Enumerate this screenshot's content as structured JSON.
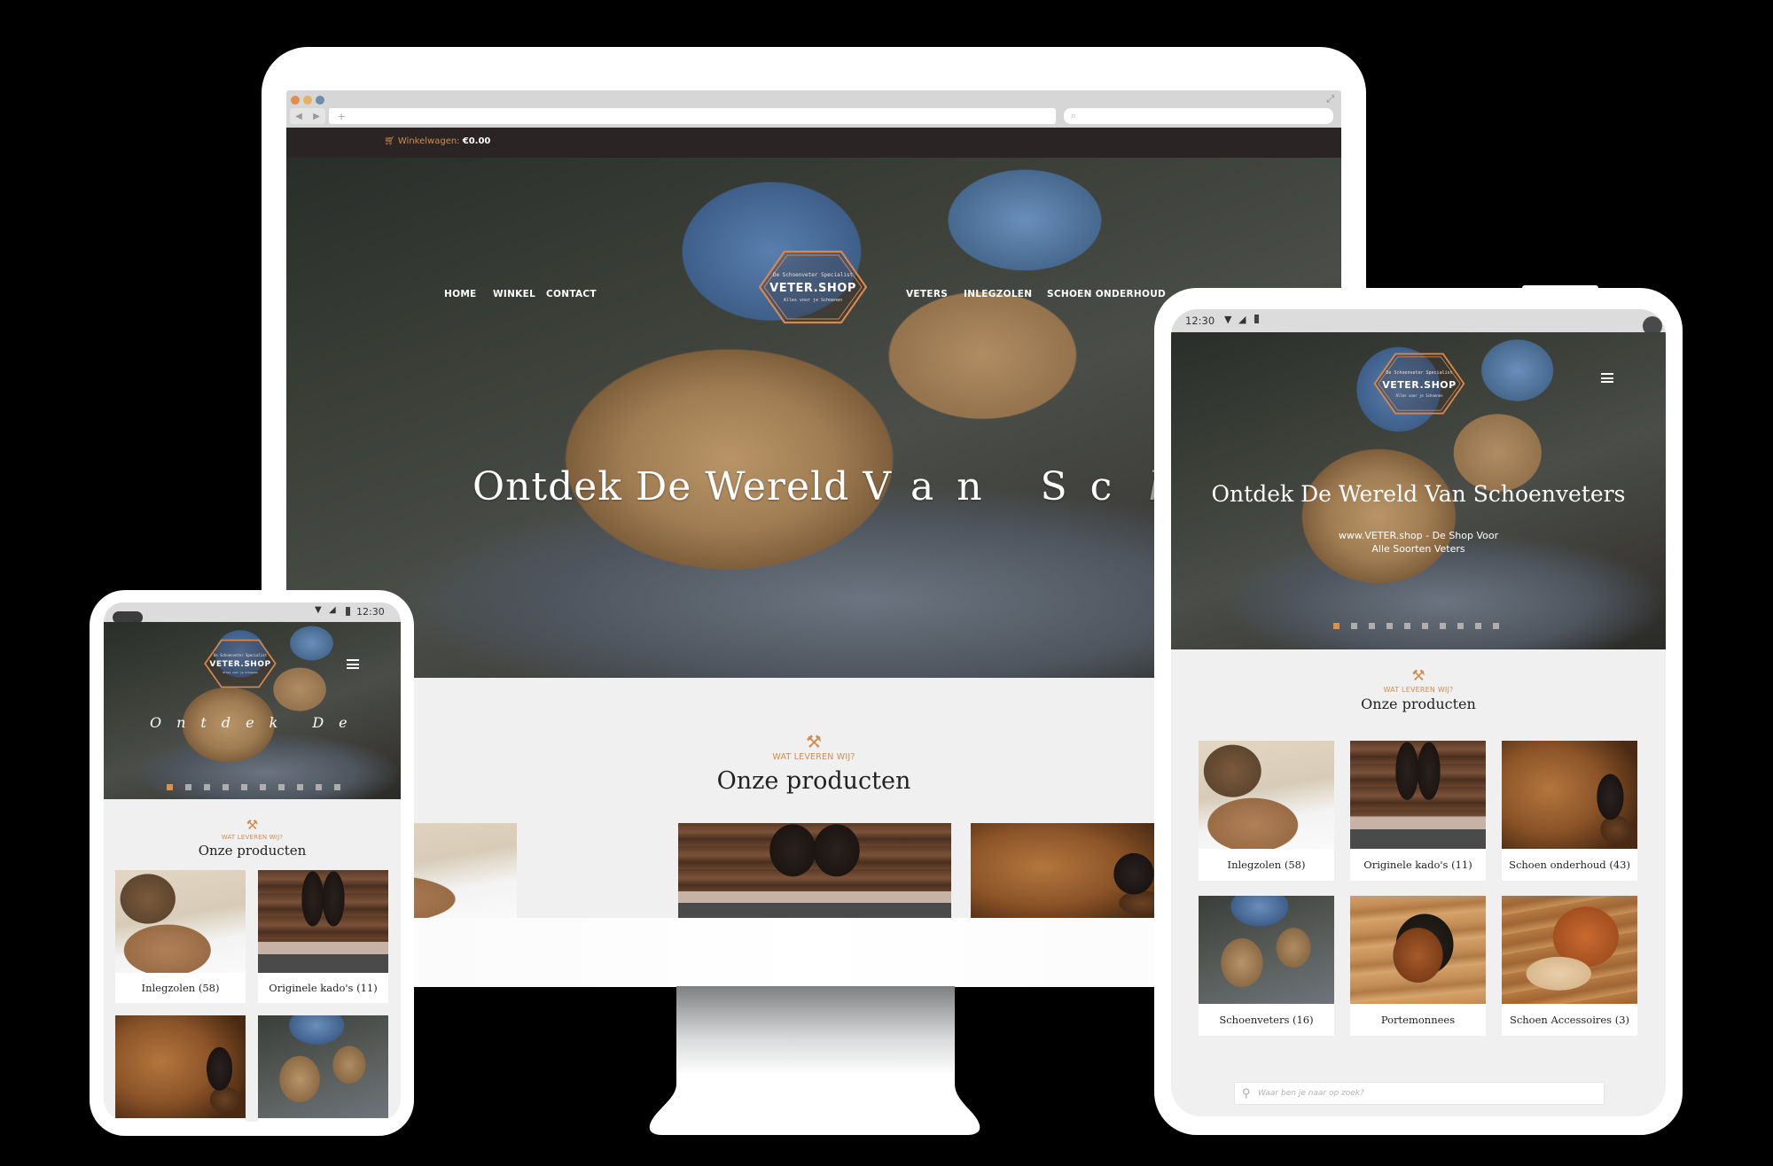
{
  "site": {
    "brand": "VETER.SHOP",
    "logo_arc_top": "De Schoenveter Specialist",
    "logo_arc_bottom": "Alles voor je Schoenen",
    "accent_color": "#d08c50",
    "cart_label": "Winkelwagen:",
    "cart_value": "€0.00",
    "nav_left": [
      "HOME",
      "WINKEL",
      "CONTACT"
    ],
    "nav_right": [
      "VETERS",
      "INLEGZOLEN",
      "SCHOEN ONDERHOUD"
    ],
    "active_nav": "HOME",
    "hero_headline": "Ontdek De Wereld Van Schoenveters",
    "hero_headline_desktop_visible": {
      "solid": "Ontdek De Wereld",
      "spread": "Van Sc",
      "fading": "h"
    },
    "hero_headline_phone_visible": "Ontdek De",
    "hero_subtitle_line1": "www.VETER.shop - De Shop Voor",
    "hero_subtitle_line2": "Alle Soorten Veters",
    "slider_dot_count": 10,
    "slider_active_index": 0,
    "section_label": "WAT LEVEREN WIJ?",
    "section_title": "Onze producten",
    "section_icon": "crossed-tools-icon",
    "search_placeholder": "Waar ben je naar op zoek?"
  },
  "categories": [
    {
      "label": "Inlegzolen (58)",
      "image": "insoles-photo"
    },
    {
      "label": "Originele kado's (11)",
      "image": "gift-shoes-photo"
    },
    {
      "label": "Schoen onderhoud (43)",
      "image": "shoe-care-photo"
    },
    {
      "label": "Schoenveters (16)",
      "image": "boots-laces-photo"
    },
    {
      "label": "Portemonnees",
      "image": "wallets-photo"
    },
    {
      "label": "Schoen Accessoires (3)",
      "image": "shoe-accessories-photo"
    }
  ],
  "browser": {
    "url": "+",
    "search_icon": "search-icon",
    "traffic_lights": [
      "#e08c4c",
      "#e8b060",
      "#6a8db0"
    ]
  },
  "device_status": {
    "time": "12:30",
    "icons": [
      "wifi-icon",
      "signal-icon",
      "battery-icon"
    ]
  }
}
